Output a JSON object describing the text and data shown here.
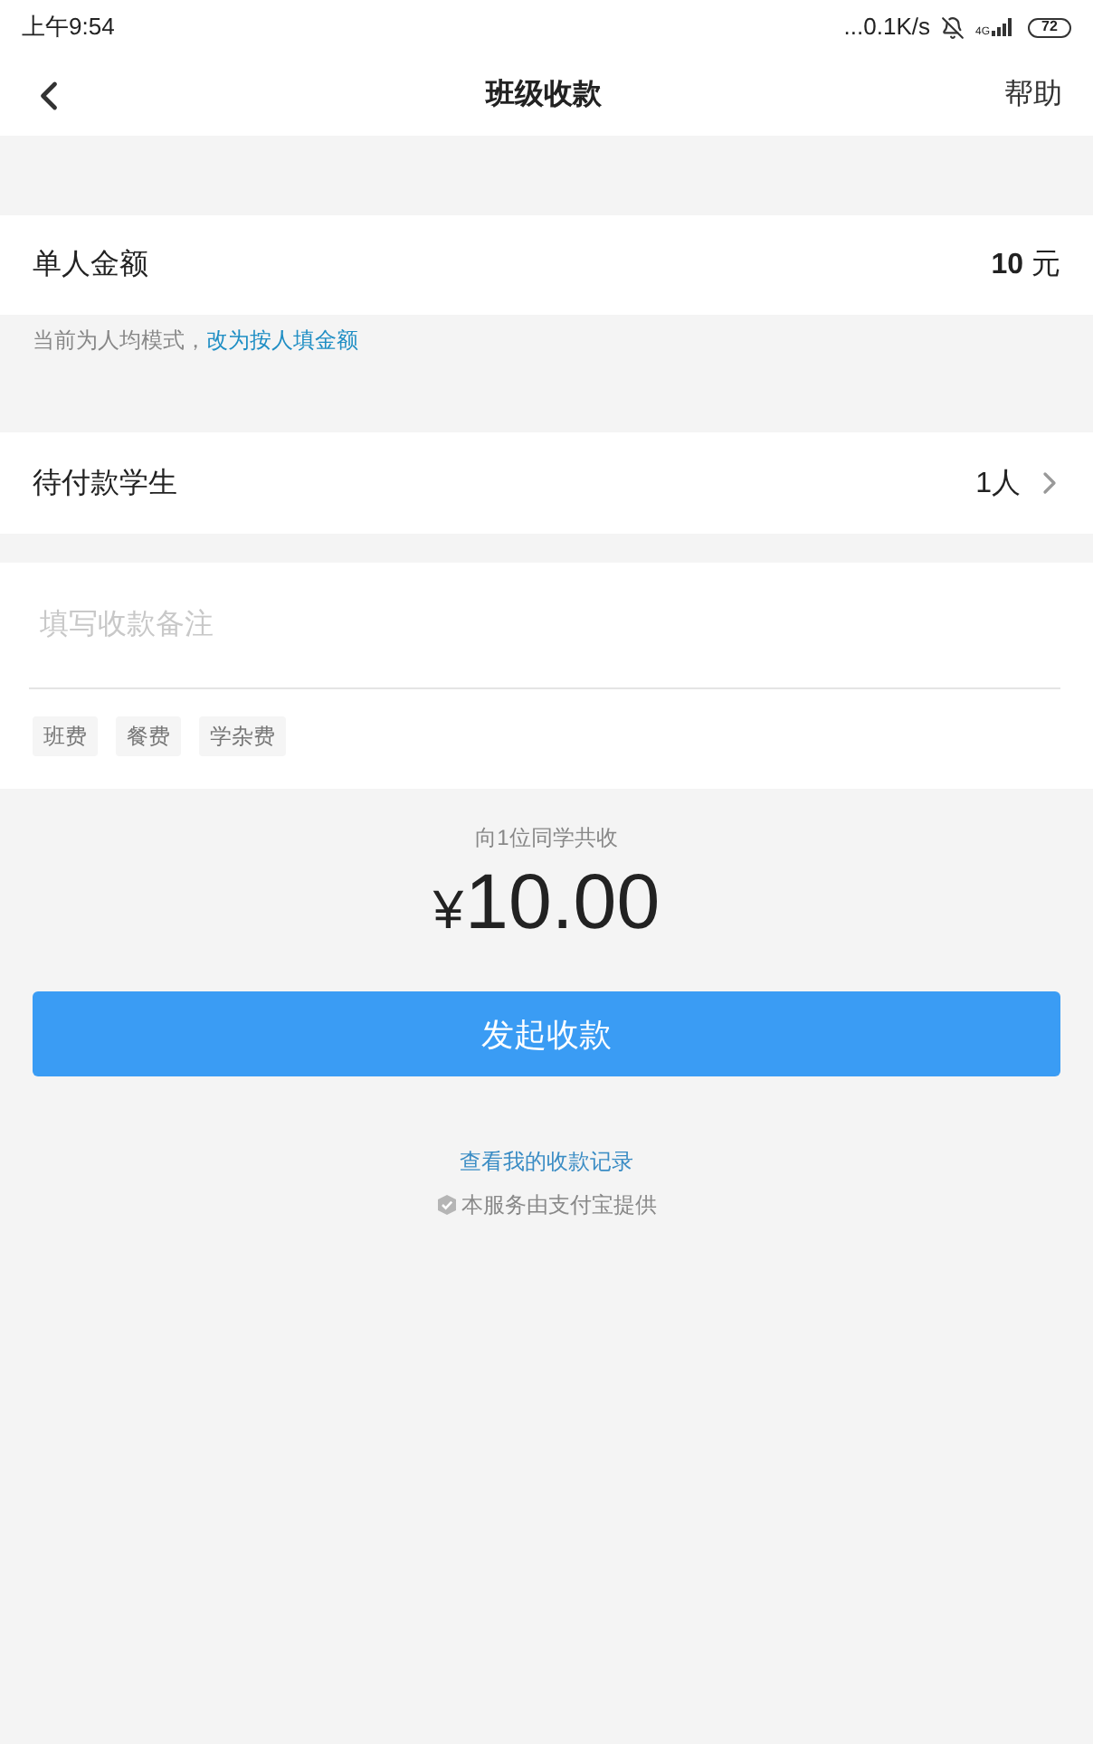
{
  "status_bar": {
    "time": "上午9:54",
    "network_speed": "...0.1K/s",
    "network_type": "4G",
    "battery": "72"
  },
  "header": {
    "title": "班级收款",
    "action": "帮助"
  },
  "amount_row": {
    "label": "单人金额",
    "value": "**10** 元"
  },
  "mode_hint": {
    "text": "当前为人均模式，",
    "link": "改为按人填金额"
  },
  "students_row": {
    "label": "待付款学生",
    "value": "1人"
  },
  "note": {
    "placeholder": "填写收款备注",
    "tags": [
      "班费",
      "餐费",
      "学杂费"
    ]
  },
  "summary": {
    "caption": "向1位同学共收",
    "currency": "¥",
    "total": "10.00"
  },
  "submit_button": "发起收款",
  "footer": {
    "records_link": "查看我的收款记录",
    "provider_note": "本服务由支付宝提供"
  }
}
